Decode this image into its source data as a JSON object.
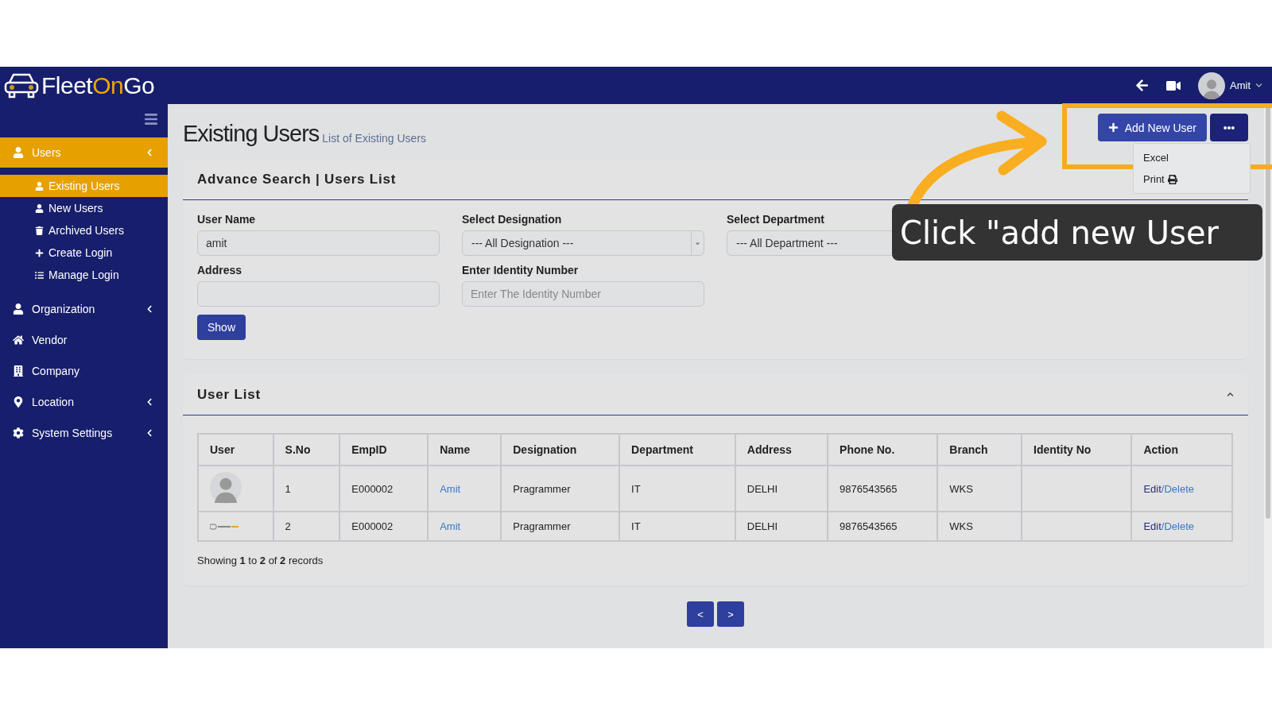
{
  "header": {
    "brand": [
      {
        "text": "Fleet",
        "accent": false
      },
      {
        "text": "On",
        "accent": true
      },
      {
        "text": "Go",
        "accent": false
      }
    ],
    "user": "Amit"
  },
  "sidebar": {
    "items": [
      {
        "label": "Users",
        "kind": "group",
        "selected": true,
        "children": [
          {
            "label": "Existing Users",
            "selected": true
          },
          {
            "label": "New Users",
            "selected": false
          },
          {
            "label": "Archived Users",
            "selected": false
          },
          {
            "label": "Create Login",
            "selected": false
          },
          {
            "label": "Manage Login",
            "selected": false
          }
        ]
      },
      {
        "label": "Organization",
        "kind": "group",
        "selected": false
      },
      {
        "label": "Vendor",
        "kind": "link",
        "selected": false
      },
      {
        "label": "Company",
        "kind": "link",
        "selected": false
      },
      {
        "label": "Location",
        "kind": "group",
        "selected": false
      },
      {
        "label": "System Settings",
        "kind": "group",
        "selected": false
      }
    ]
  },
  "page": {
    "title": "Existing Users",
    "subtitle": "List of Existing Users",
    "add_button": "Add New User",
    "menu": [
      "Excel",
      "Print"
    ]
  },
  "search": {
    "title": "Advance Search | Users List",
    "fields": [
      {
        "label": "User Name",
        "kind": "text",
        "value": "amit"
      },
      {
        "label": "Select Designation",
        "kind": "select",
        "value": "--- All Designation ---"
      },
      {
        "label": "Select Department",
        "kind": "select",
        "value": "--- All Department ---"
      },
      {
        "label": "Address",
        "kind": "text"
      },
      {
        "label": "Enter Identity Number",
        "kind": "text",
        "placeholder": "Enter The Identity Number"
      }
    ],
    "button": "Show"
  },
  "user_list": {
    "title": "User List",
    "columns": [
      "User",
      "S.No",
      "EmpID",
      "Name",
      "Designation",
      "Department",
      "Address",
      "Phone No.",
      "Branch",
      "Identity No",
      "Action"
    ],
    "rows": [
      {
        "user": {
          "kind": "avatar"
        },
        "sno": "1",
        "empid": "E000002",
        "name": "Amit",
        "designation": "Pragrammer",
        "department": "IT",
        "address": "DELHI",
        "phone": "9876543565",
        "branch": "WKS",
        "edit": "Edit",
        "delete": "/Delete"
      },
      {
        "user": {
          "kind": "logo"
        },
        "sno": "2",
        "empid": "E000002",
        "name": "Amit",
        "designation": "Pragrammer",
        "department": "IT",
        "address": "DELHI",
        "phone": "9876543565",
        "branch": "WKS",
        "edit": "Edit",
        "delete": "/Delete"
      }
    ],
    "footer": "Showing **1** to **2** of **2** records"
  },
  "pagination": [
    "<",
    ">"
  ],
  "annotation": {
    "text": "Click \"add new User"
  }
}
